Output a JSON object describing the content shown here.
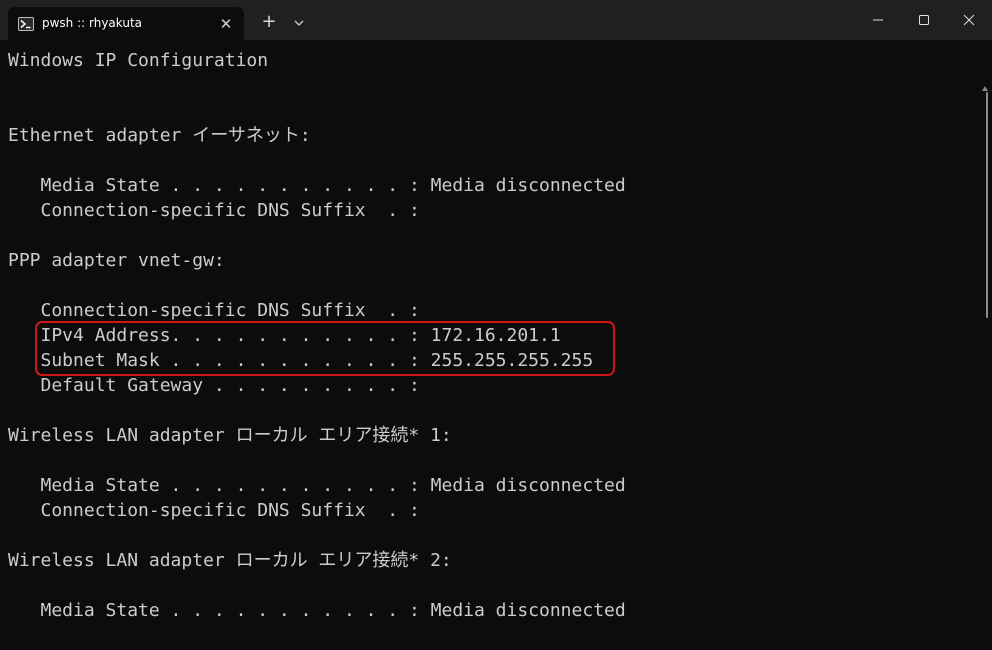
{
  "tab": {
    "title": "pwsh :: rhyakuta",
    "icon": "powershell-icon",
    "close_label": "✕"
  },
  "titlebar": {
    "new_tab_label": "+",
    "dropdown_icon": "chevron-down-icon",
    "minimize_icon": "minimize-icon",
    "maximize_icon": "maximize-icon",
    "close_icon": "close-icon"
  },
  "terminal": {
    "lines": [
      "Windows IP Configuration",
      "",
      "",
      "Ethernet adapter イーサネット:",
      "",
      "   Media State . . . . . . . . . . . : Media disconnected",
      "   Connection-specific DNS Suffix  . :",
      "",
      "PPP adapter vnet-gw:",
      "",
      "   Connection-specific DNS Suffix  . :",
      "   IPv4 Address. . . . . . . . . . . : 172.16.201.1",
      "   Subnet Mask . . . . . . . . . . . : 255.255.255.255",
      "   Default Gateway . . . . . . . . . :",
      "",
      "Wireless LAN adapter ローカル エリア接続* 1:",
      "",
      "   Media State . . . . . . . . . . . : Media disconnected",
      "   Connection-specific DNS Suffix  . :",
      "",
      "Wireless LAN adapter ローカル エリア接続* 2:",
      "",
      "   Media State . . . . . . . . . . . : Media disconnected"
    ]
  },
  "colors": {
    "terminal_bg": "#0c0c0c",
    "terminal_fg": "#cccccc",
    "titlebar_bg": "#202020",
    "highlight_border": "#d01616"
  }
}
